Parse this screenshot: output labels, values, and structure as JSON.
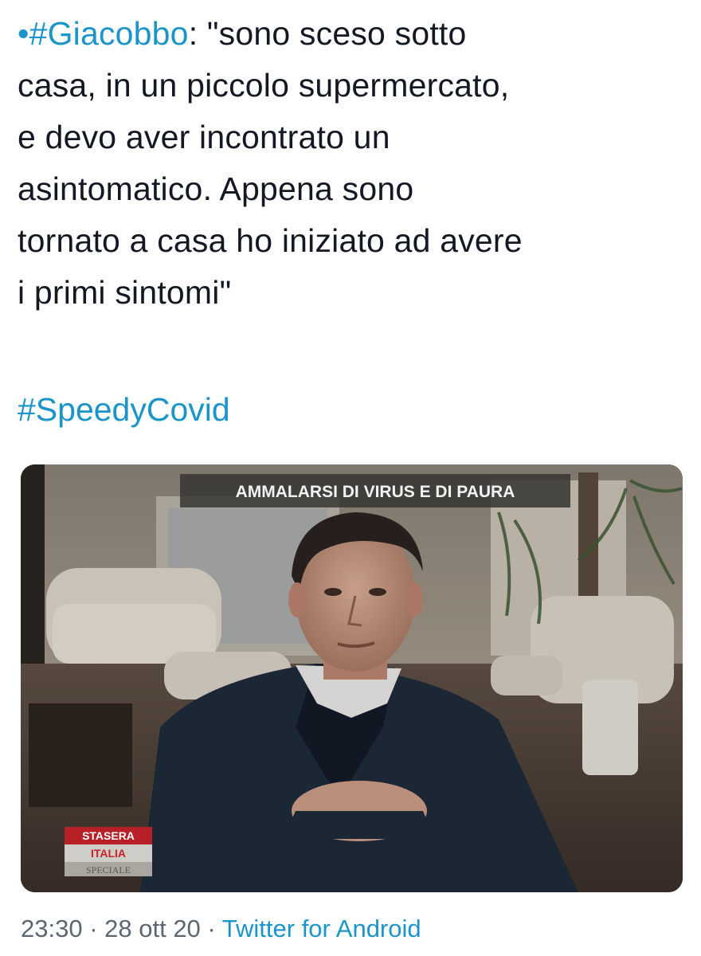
{
  "tweet": {
    "bullet": "•",
    "hashtag_name": "#Giacobbo",
    "lines": [
      ": \"sono sceso sotto",
      "casa, in un piccolo supermercato,",
      "e devo aver incontrato un",
      "asintomatico. Appena sono",
      "tornato a casa ho iniziato ad avere",
      "i primi sintomi\""
    ],
    "hashtag_topic": "#SpeedyCovid"
  },
  "media": {
    "caption_banner": "AMMALARSI DI VIRUS E DI PAURA",
    "show_logo_top": "STASERA",
    "show_logo_mid": "ITALIA",
    "show_logo_bottom": "SPECIALE"
  },
  "meta": {
    "time": "23:30",
    "separator_1": " · ",
    "date": "28 ott 20",
    "separator_2": " · ",
    "source": "Twitter for Android"
  },
  "colors": {
    "hashtag": "#1b95c9",
    "text": "#141823",
    "meta": "#5b6670"
  }
}
